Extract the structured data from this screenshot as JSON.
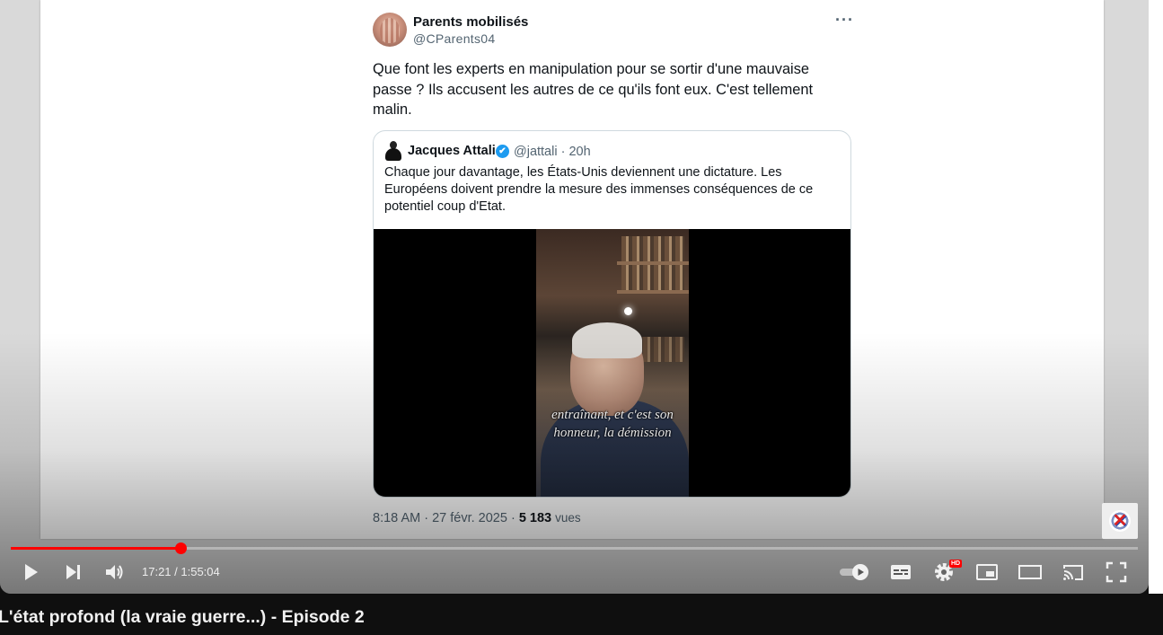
{
  "tweet": {
    "author_name": "Parents mobilisés",
    "author_handle": "@CParents04",
    "more_label": "···",
    "text": "Que font les experts en manipulation pour se sortir d'une mauvaise passe ? Ils accusent les autres de ce qu'ils font eux. C'est tellement malin.",
    "footer_time": "8:18 AM · 27 févr. 2025 · ",
    "views_count": "5 183",
    "views_label": "vues"
  },
  "quote": {
    "author_name": "Jacques Attali",
    "meta": "@jattali · 20h",
    "verified_icon": "✔",
    "text": "Chaque jour davantage, les États-Unis deviennent une dictature. Les Européens doivent prendre la mesure des immenses conséquences de ce potentiel coup d'Etat.",
    "video_subtitle": "entraînant, et c'est son honneur, la démission"
  },
  "player": {
    "time_display": "17:21 / 1:55:04",
    "progress": 0.1502,
    "hd_badge": "HD",
    "accent": "#ff0000",
    "icons": [
      "play-icon",
      "next-icon",
      "volume-icon",
      "autoplay-toggle-icon",
      "subtitles-icon",
      "settings-icon",
      "miniplayer-icon",
      "theater-icon",
      "cast-icon",
      "fullscreen-icon"
    ]
  },
  "video": {
    "title": "L'état profond (la vraie guerre...) - Episode 2"
  }
}
